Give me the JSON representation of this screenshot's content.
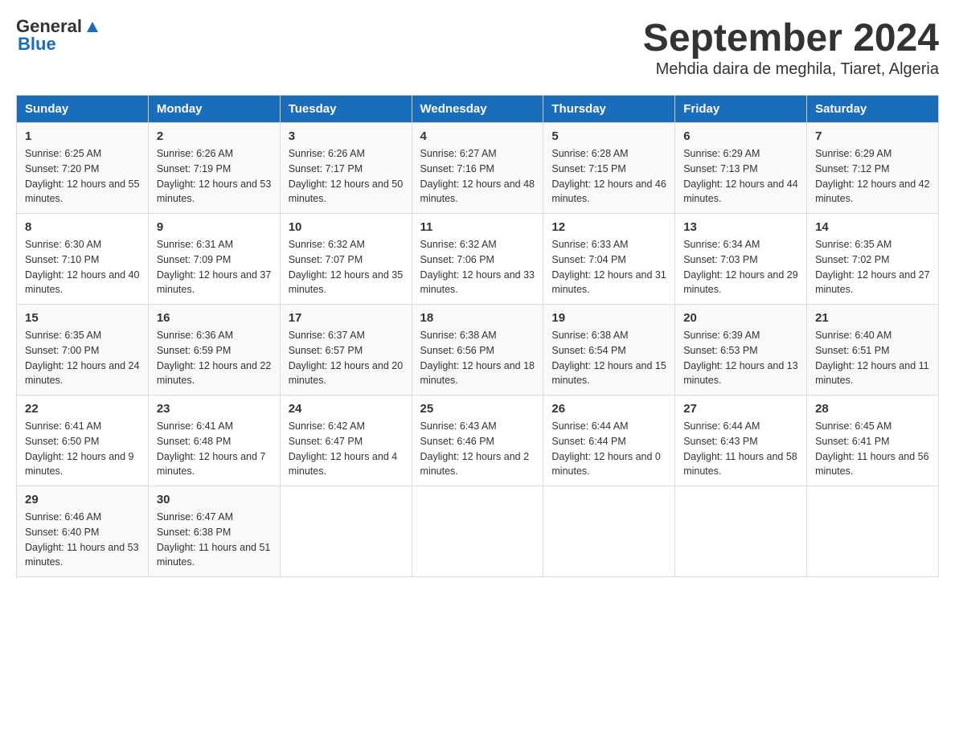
{
  "header": {
    "logo_general": "General",
    "logo_blue": "Blue",
    "title": "September 2024",
    "location": "Mehdia daira de meghila, Tiaret, Algeria"
  },
  "days_of_week": [
    "Sunday",
    "Monday",
    "Tuesday",
    "Wednesday",
    "Thursday",
    "Friday",
    "Saturday"
  ],
  "weeks": [
    [
      {
        "day": "1",
        "sunrise": "6:25 AM",
        "sunset": "7:20 PM",
        "daylight": "12 hours and 55 minutes."
      },
      {
        "day": "2",
        "sunrise": "6:26 AM",
        "sunset": "7:19 PM",
        "daylight": "12 hours and 53 minutes."
      },
      {
        "day": "3",
        "sunrise": "6:26 AM",
        "sunset": "7:17 PM",
        "daylight": "12 hours and 50 minutes."
      },
      {
        "day": "4",
        "sunrise": "6:27 AM",
        "sunset": "7:16 PM",
        "daylight": "12 hours and 48 minutes."
      },
      {
        "day": "5",
        "sunrise": "6:28 AM",
        "sunset": "7:15 PM",
        "daylight": "12 hours and 46 minutes."
      },
      {
        "day": "6",
        "sunrise": "6:29 AM",
        "sunset": "7:13 PM",
        "daylight": "12 hours and 44 minutes."
      },
      {
        "day": "7",
        "sunrise": "6:29 AM",
        "sunset": "7:12 PM",
        "daylight": "12 hours and 42 minutes."
      }
    ],
    [
      {
        "day": "8",
        "sunrise": "6:30 AM",
        "sunset": "7:10 PM",
        "daylight": "12 hours and 40 minutes."
      },
      {
        "day": "9",
        "sunrise": "6:31 AM",
        "sunset": "7:09 PM",
        "daylight": "12 hours and 37 minutes."
      },
      {
        "day": "10",
        "sunrise": "6:32 AM",
        "sunset": "7:07 PM",
        "daylight": "12 hours and 35 minutes."
      },
      {
        "day": "11",
        "sunrise": "6:32 AM",
        "sunset": "7:06 PM",
        "daylight": "12 hours and 33 minutes."
      },
      {
        "day": "12",
        "sunrise": "6:33 AM",
        "sunset": "7:04 PM",
        "daylight": "12 hours and 31 minutes."
      },
      {
        "day": "13",
        "sunrise": "6:34 AM",
        "sunset": "7:03 PM",
        "daylight": "12 hours and 29 minutes."
      },
      {
        "day": "14",
        "sunrise": "6:35 AM",
        "sunset": "7:02 PM",
        "daylight": "12 hours and 27 minutes."
      }
    ],
    [
      {
        "day": "15",
        "sunrise": "6:35 AM",
        "sunset": "7:00 PM",
        "daylight": "12 hours and 24 minutes."
      },
      {
        "day": "16",
        "sunrise": "6:36 AM",
        "sunset": "6:59 PM",
        "daylight": "12 hours and 22 minutes."
      },
      {
        "day": "17",
        "sunrise": "6:37 AM",
        "sunset": "6:57 PM",
        "daylight": "12 hours and 20 minutes."
      },
      {
        "day": "18",
        "sunrise": "6:38 AM",
        "sunset": "6:56 PM",
        "daylight": "12 hours and 18 minutes."
      },
      {
        "day": "19",
        "sunrise": "6:38 AM",
        "sunset": "6:54 PM",
        "daylight": "12 hours and 15 minutes."
      },
      {
        "day": "20",
        "sunrise": "6:39 AM",
        "sunset": "6:53 PM",
        "daylight": "12 hours and 13 minutes."
      },
      {
        "day": "21",
        "sunrise": "6:40 AM",
        "sunset": "6:51 PM",
        "daylight": "12 hours and 11 minutes."
      }
    ],
    [
      {
        "day": "22",
        "sunrise": "6:41 AM",
        "sunset": "6:50 PM",
        "daylight": "12 hours and 9 minutes."
      },
      {
        "day": "23",
        "sunrise": "6:41 AM",
        "sunset": "6:48 PM",
        "daylight": "12 hours and 7 minutes."
      },
      {
        "day": "24",
        "sunrise": "6:42 AM",
        "sunset": "6:47 PM",
        "daylight": "12 hours and 4 minutes."
      },
      {
        "day": "25",
        "sunrise": "6:43 AM",
        "sunset": "6:46 PM",
        "daylight": "12 hours and 2 minutes."
      },
      {
        "day": "26",
        "sunrise": "6:44 AM",
        "sunset": "6:44 PM",
        "daylight": "12 hours and 0 minutes."
      },
      {
        "day": "27",
        "sunrise": "6:44 AM",
        "sunset": "6:43 PM",
        "daylight": "11 hours and 58 minutes."
      },
      {
        "day": "28",
        "sunrise": "6:45 AM",
        "sunset": "6:41 PM",
        "daylight": "11 hours and 56 minutes."
      }
    ],
    [
      {
        "day": "29",
        "sunrise": "6:46 AM",
        "sunset": "6:40 PM",
        "daylight": "11 hours and 53 minutes."
      },
      {
        "day": "30",
        "sunrise": "6:47 AM",
        "sunset": "6:38 PM",
        "daylight": "11 hours and 51 minutes."
      },
      null,
      null,
      null,
      null,
      null
    ]
  ]
}
